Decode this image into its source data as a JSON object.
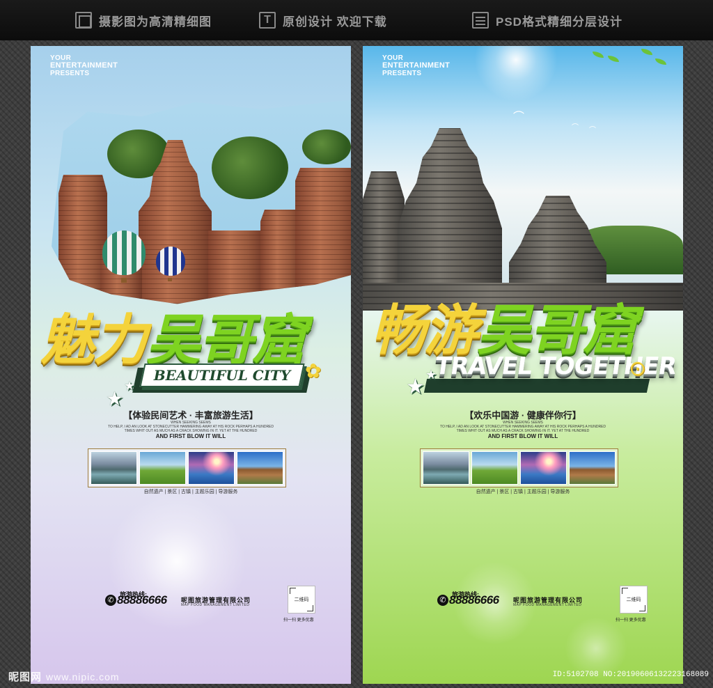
{
  "topbar": {
    "features": [
      {
        "icon": "photo-icon",
        "label": "摄影图为高清精细图"
      },
      {
        "icon": "text-icon",
        "label": "原创设计 欢迎下载"
      },
      {
        "icon": "layers-icon",
        "label": "PSD格式精细分层设计"
      }
    ]
  },
  "posters": [
    {
      "brand": [
        "YOUR",
        "ENTERTAINMENT",
        "PRESENTS"
      ],
      "title_yellow": "魅力",
      "title_green": "吴哥窟",
      "english_title": "BEAUTIFUL CITY",
      "subtitle": "【体验民间艺术 · 丰富旅游生活】",
      "small_text": [
        "WHEN SEEKING SEEMS",
        "TO HELP, I AD AN LOOK AT STONECUTTER HAMMERING AWAY AT HIS ROCK PERHAPS A HUNDRED",
        "TIMES WHIT OUT AS MUCH AS A CRACK SHOWING IN IT. YET AT THE HUNDRED"
      ],
      "small_text_bold": "AND FIRST BLOW IT WILL",
      "tags": "自然遗产 | 景区 | 古镇 | 主题乐园 | 导游服务",
      "hotline_label": "旅游热线:",
      "phone": "88886666",
      "company": "呢图旅游管理有限公司",
      "company_en": "MAP FOOD MANAGEMENT LIMITED",
      "qr_label": "二维码",
      "qr_caption": "扫一扫  更多优惠"
    },
    {
      "brand": [
        "YOUR",
        "ENTERTAINMENT",
        "PRESENTS"
      ],
      "title_yellow": "畅游",
      "title_green": "吴哥窟",
      "english_title": "TRAVEL TOGETHER",
      "subtitle": "【欢乐中国游 · 健康伴你行】",
      "small_text": [
        "WHEN SEEKING SEEMS",
        "TO HELP, I AD AN LOOK AT STONECUTTER HAMMERING AWAY AT HIS ROCK PERHAPS A HUNDRED",
        "TIMES WHIT OUT AS MUCH AS A CRACK SHOWING IN IT. YET AT THE HUNDRED"
      ],
      "small_text_bold": "AND FIRST BLOW IT WILL",
      "tags": "自然遗产 | 景区 | 古镇 | 主题乐园 | 导游服务",
      "hotline_label": "旅游热线:",
      "phone": "88886666",
      "company": "呢图旅游管理有限公司",
      "company_en": "MAP FOOD MANAGEMENT LIMITED",
      "qr_label": "二维码",
      "qr_caption": "扫一扫  更多优惠"
    }
  ],
  "watermark": {
    "logo": "昵图网",
    "url": "www.nipic.com",
    "image_id": "ID:5102708 NO:20190606132223168089"
  },
  "colors": {
    "title_yellow": "#f4d33b",
    "title_green": "#7ed321",
    "ribbon_dark": "#1f3e2c",
    "topbar_bg": "#111111"
  }
}
